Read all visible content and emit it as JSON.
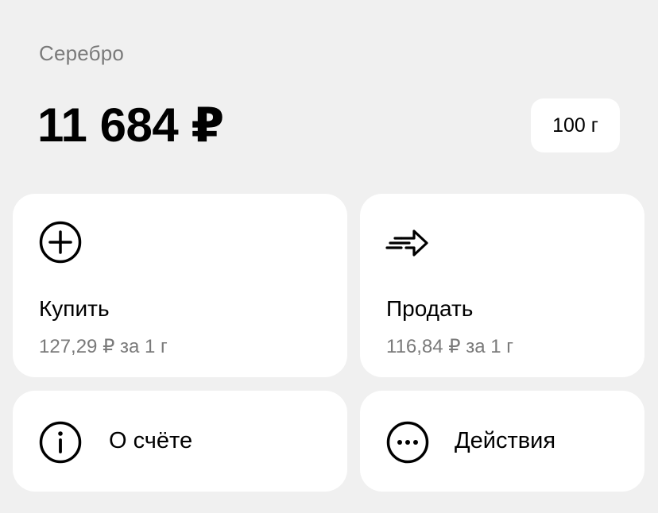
{
  "header": {
    "asset_name": "Серебро",
    "balance": "11 684 ₽",
    "weight": "100 г"
  },
  "buy": {
    "title": "Купить",
    "price": "127,29 ₽ за 1 г",
    "icon": "plus-circle-icon"
  },
  "sell": {
    "title": "Продать",
    "price": "116,84 ₽ за 1 г",
    "icon": "send-arrow-icon"
  },
  "account": {
    "label": "О счёте",
    "icon": "info-icon"
  },
  "actions": {
    "label": "Действия",
    "icon": "more-icon"
  },
  "colors": {
    "background": "#f0f0f0",
    "card": "#ffffff",
    "secondary_text": "#7a7a7a"
  }
}
